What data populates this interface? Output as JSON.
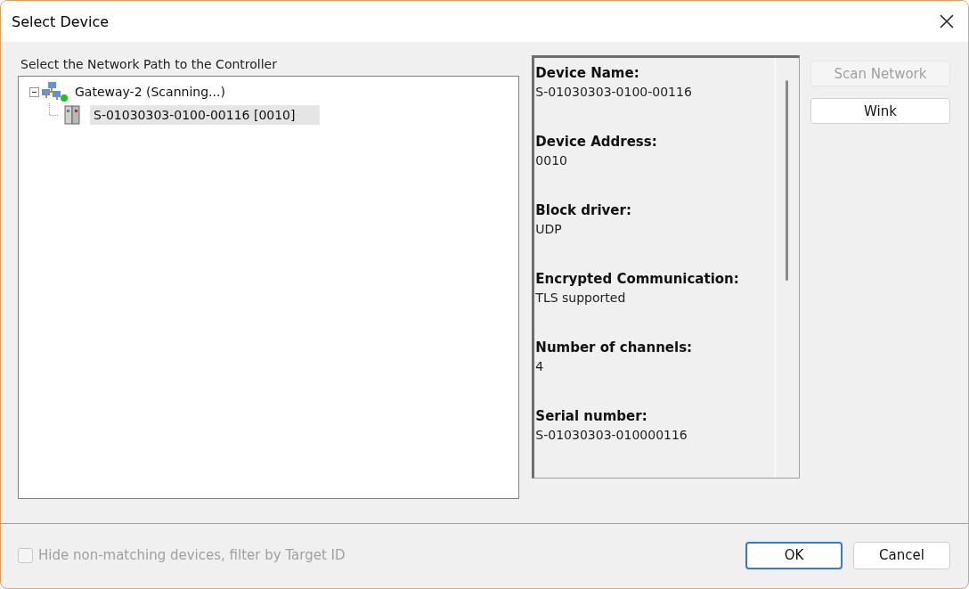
{
  "window": {
    "title": "Select Device"
  },
  "tree_label": "Select the Network Path to the Controller",
  "tree": [
    {
      "label": "Gateway-2 (Scanning...)",
      "kind": "gateway",
      "expanded": true,
      "selected": false,
      "children": [
        {
          "label": "S-01030303-0100-00116 [0010]",
          "kind": "device",
          "selected": true
        }
      ]
    }
  ],
  "details": [
    {
      "label": "Device Name:",
      "value": "S-01030303-0100-00116"
    },
    {
      "label": "Device Address:",
      "value": "0010"
    },
    {
      "label": "Block driver:",
      "value": "UDP"
    },
    {
      "label": "Encrypted Communication:",
      "value": "TLS supported"
    },
    {
      "label": "Number of channels:",
      "value": "4"
    },
    {
      "label": "Serial number:",
      "value": "S-01030303-010000116"
    }
  ],
  "side_buttons": [
    {
      "label": "Scan Network",
      "disabled": true
    },
    {
      "label": "Wink",
      "disabled": false
    }
  ],
  "filter": {
    "label": "Hide non-matching devices, filter by Target ID",
    "checked": false,
    "disabled": true
  },
  "buttons": [
    {
      "label": "OK",
      "default": true
    },
    {
      "label": "Cancel",
      "default": false
    }
  ]
}
